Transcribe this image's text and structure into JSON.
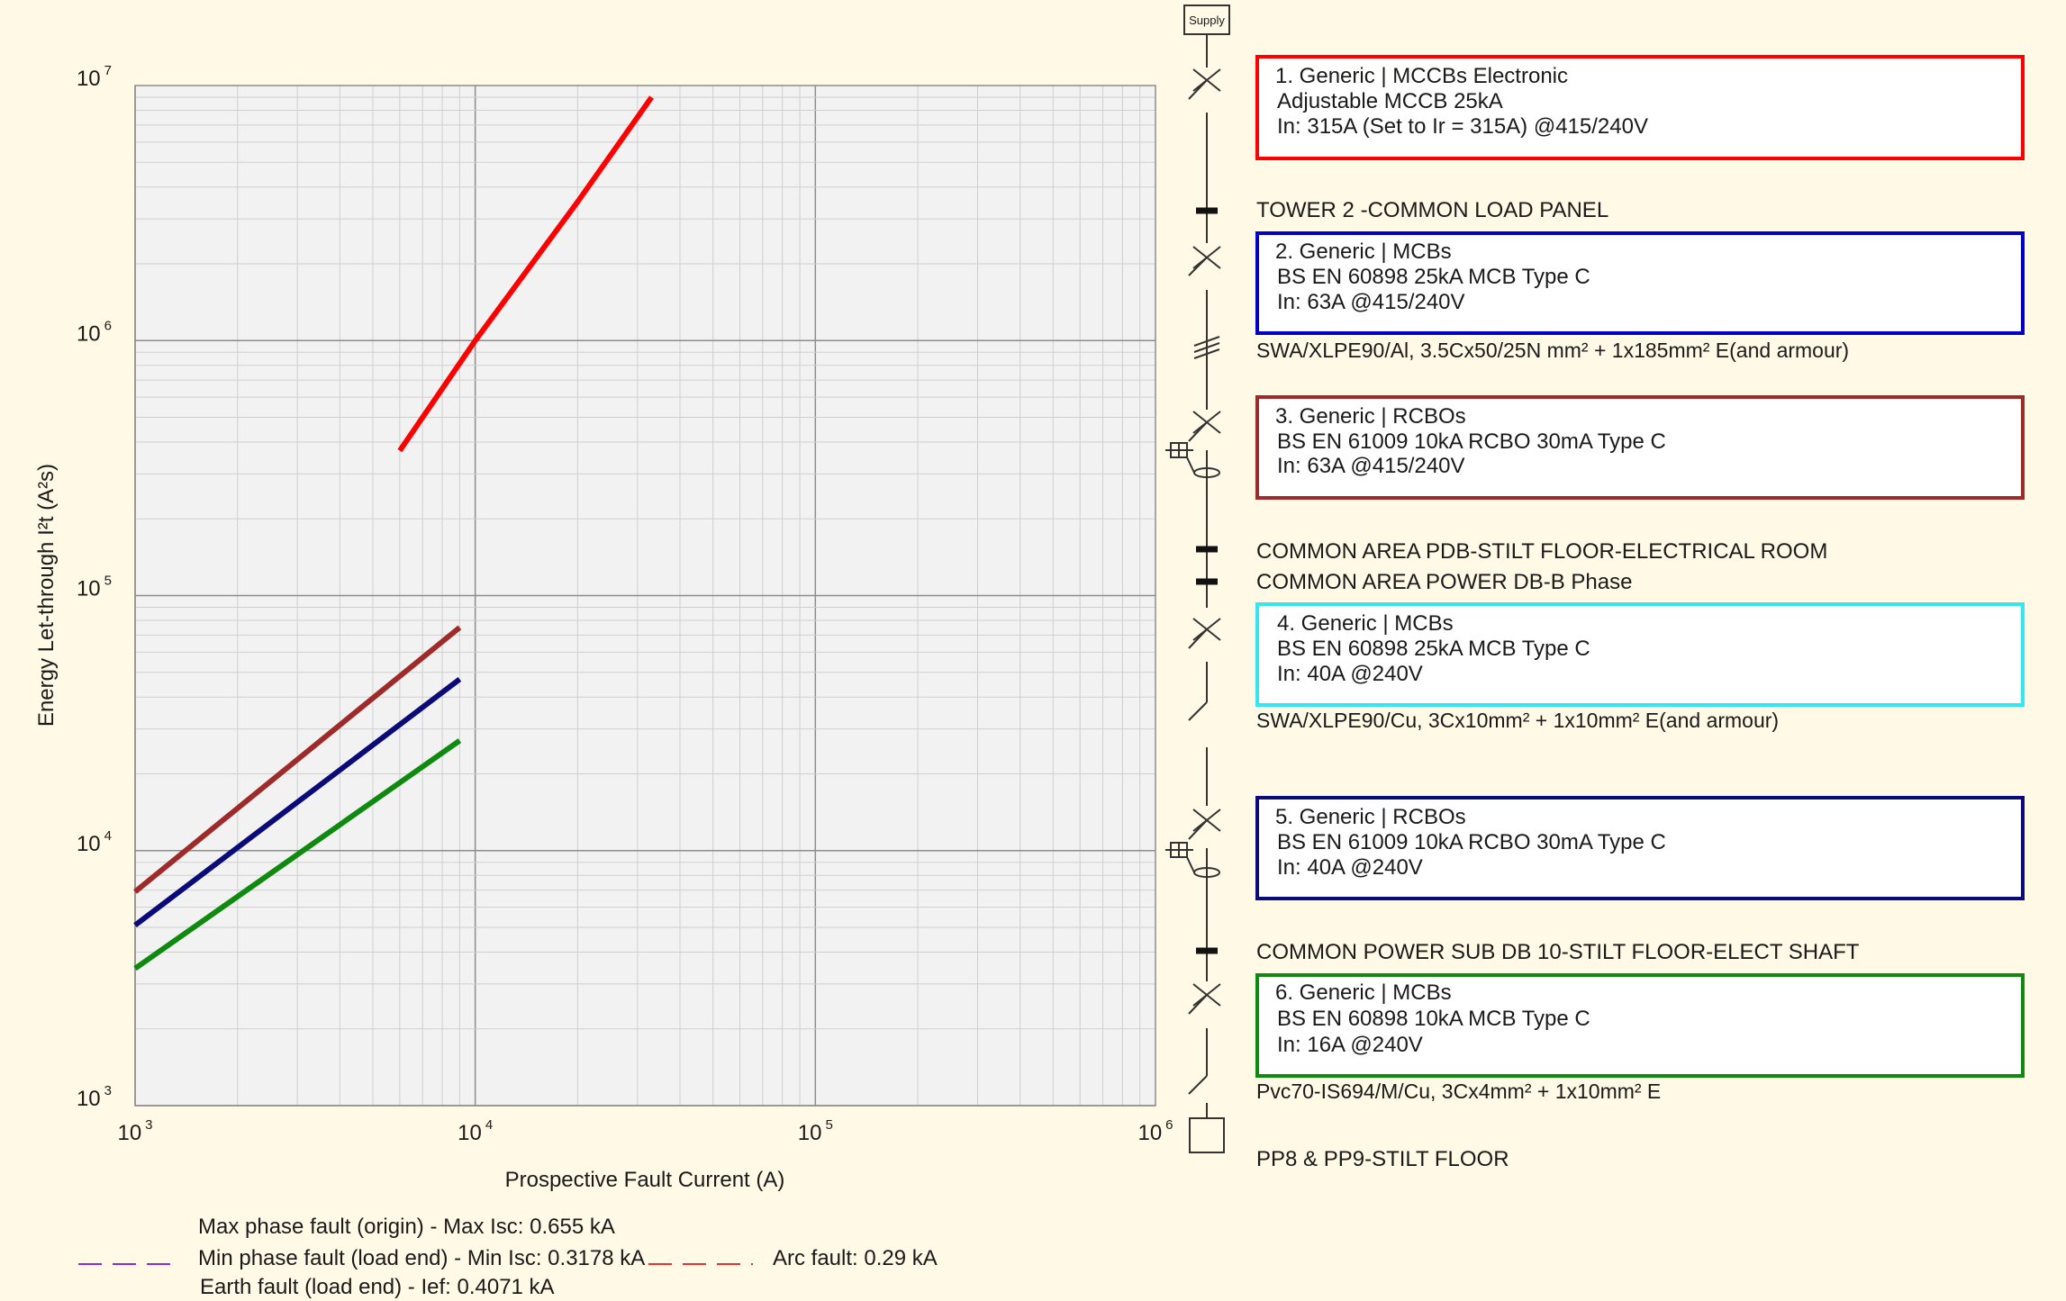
{
  "chart_data": {
    "type": "line",
    "x_scale": "log",
    "y_scale": "log",
    "xlim": [
      1000,
      1000000
    ],
    "ylim": [
      1000,
      10000000
    ],
    "grid": true,
    "xlabel": "Prospective Fault Current (A)",
    "ylabel": "Energy Let-through I²t (A²s)",
    "x_ticks": [
      {
        "base": "10",
        "exp": "3",
        "value": 1000
      },
      {
        "base": "10",
        "exp": "4",
        "value": 10000
      },
      {
        "base": "10",
        "exp": "5",
        "value": 100000
      },
      {
        "base": "10",
        "exp": "6",
        "value": 1000000
      }
    ],
    "y_ticks": [
      {
        "base": "10",
        "exp": "3",
        "value": 1000
      },
      {
        "base": "10",
        "exp": "4",
        "value": 10000
      },
      {
        "base": "10",
        "exp": "5",
        "value": 100000
      },
      {
        "base": "10",
        "exp": "6",
        "value": 1000000
      },
      {
        "base": "10",
        "exp": "7",
        "value": 10000000
      }
    ],
    "series": [
      {
        "color": "#ff0000",
        "x": [
          6000,
          10000,
          20000,
          33000
        ],
        "y": [
          370000,
          1000000,
          3500000,
          9000000
        ]
      },
      {
        "color": "#9e2a2a",
        "x": [
          1000,
          9000
        ],
        "y": [
          6900,
          75000
        ]
      },
      {
        "color": "#0a0a78",
        "x": [
          1000,
          9000
        ],
        "y": [
          5100,
          47000
        ]
      },
      {
        "color": "#0f8a0f",
        "x": [
          1000,
          9000
        ],
        "y": [
          3450,
          27000
        ]
      }
    ]
  },
  "legend": {
    "max_phase": "Max phase fault (origin) - Max Isc: 0.655 kA",
    "min_phase": "Min phase fault (load end) - Min Isc: 0.3178 kA",
    "arc": "Arc fault: 0.29 kA",
    "earth": "Earth fault (load end) - Ief: 0.4071 kA",
    "colors": {
      "min_phase": "#8a2be2",
      "arc": "#e83030"
    }
  },
  "diagram": {
    "supply": "Supply",
    "devices": [
      {
        "lines": [
          "1. Generic | MCCBs Electronic",
          "Adjustable MCCB 25kA",
          "In: 315A (Set to Ir = 315A) @415/240V"
        ],
        "color": "#ff0000"
      },
      {
        "lines": [
          "2. Generic | MCBs",
          "BS EN 60898 25kA MCB Type C",
          "In: 63A @415/240V"
        ],
        "color": "#0000cc"
      },
      {
        "lines": [
          "3. Generic | RCBOs",
          "BS EN 61009 10kA RCBO 30mA Type C",
          "In: 63A @415/240V"
        ],
        "color": "#9e2a2a"
      },
      {
        "lines": [
          "4. Generic | MCBs",
          "BS EN 60898 25kA MCB Type C",
          "In: 40A @240V"
        ],
        "color": "#33e6f2"
      },
      {
        "lines": [
          "5. Generic | RCBOs",
          "BS EN 61009 10kA RCBO 30mA Type C",
          "In: 40A @240V"
        ],
        "color": "#0a0a78"
      },
      {
        "lines": [
          "6. Generic | MCBs",
          "BS EN 60898 10kA MCB Type C",
          "In: 16A @240V"
        ],
        "color": "#0f8a0f"
      }
    ],
    "buses": [
      "TOWER 2 -COMMON LOAD PANEL",
      "COMMON AREA PDB-STILT FLOOR-ELECTRICAL ROOM",
      "COMMON AREA POWER DB-B Phase",
      "COMMON POWER SUB DB 10-STILT FLOOR-ELECT SHAFT",
      "PP8 & PP9-STILT FLOOR"
    ],
    "cables": [
      "SWA/XLPE90/Al, 3.5Cx50/25N mm² + 1x185mm² E(and armour)",
      "SWA/XLPE90/Cu, 3Cx10mm² + 1x10mm² E(and armour)",
      "Pvc70-IS694/M/Cu, 3Cx4mm² + 1x10mm² E"
    ]
  }
}
